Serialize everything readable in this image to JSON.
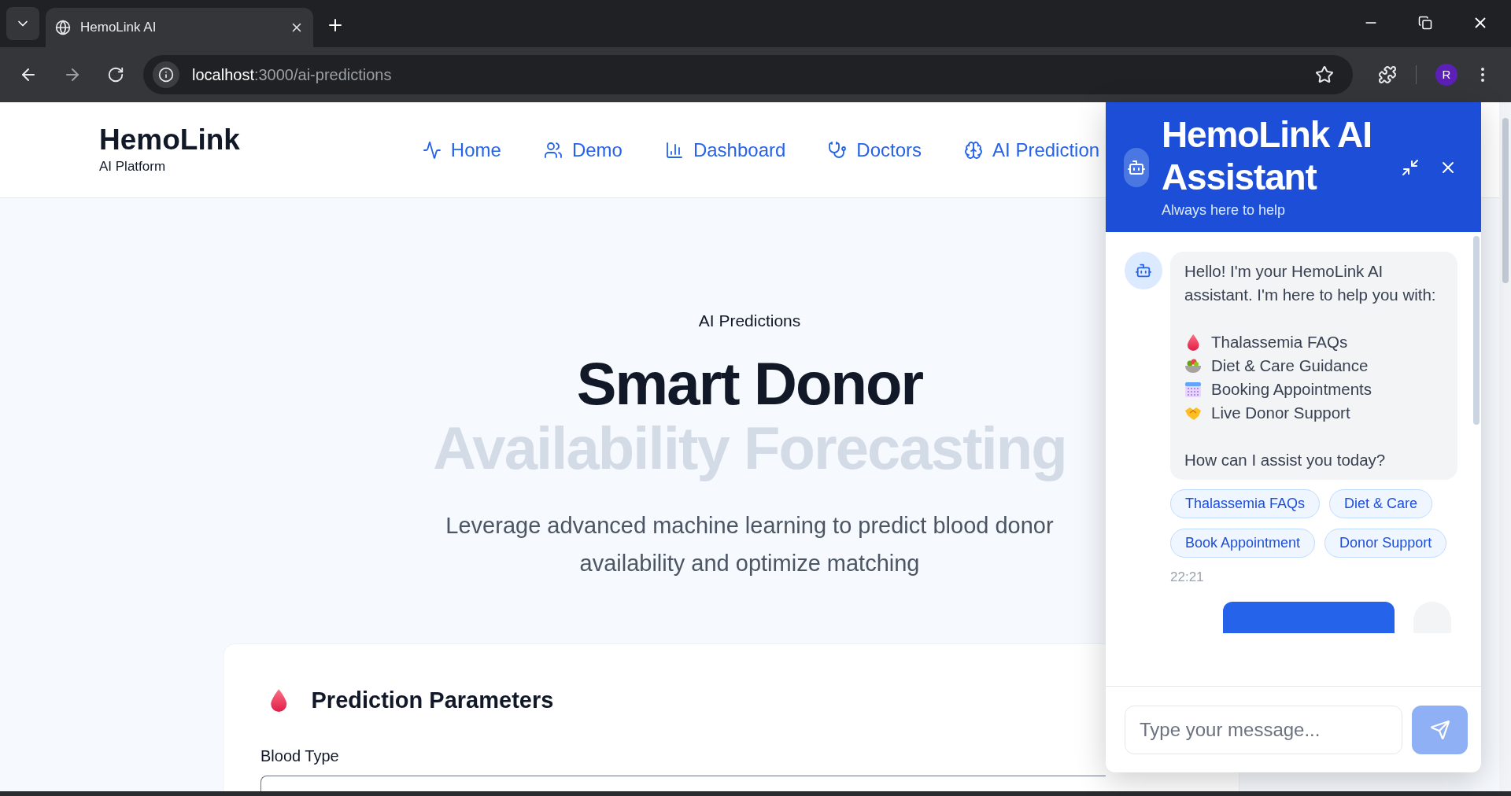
{
  "browser": {
    "tab_title": "HemoLink AI",
    "url_host": "localhost",
    "url_path": ":3000/ai-predictions",
    "profile_initial": "R"
  },
  "header": {
    "brand": "HemoLink",
    "tagline": "AI Platform",
    "nav": [
      {
        "kind": "home",
        "label": "Home"
      },
      {
        "kind": "demo",
        "label": "Demo"
      },
      {
        "kind": "dashboard",
        "label": "Dashboard"
      },
      {
        "kind": "doctors",
        "label": "Doctors"
      },
      {
        "kind": "predictions",
        "label": "AI Prediction"
      }
    ]
  },
  "hero": {
    "eyebrow": "AI Predictions",
    "title": "Smart Donor",
    "title_faded": "Availability Forecasting",
    "subtitle": "Leverage advanced machine learning to predict blood donor availability and optimize matching"
  },
  "card": {
    "title": "Prediction Parameters",
    "field_label": "Blood Type"
  },
  "chat": {
    "title": "HemoLink AI Assistant",
    "subtitle": "Always here to help",
    "greeting": "Hello! I'm your HemoLink AI assistant. I'm here to help you with:",
    "topics": [
      {
        "kind": "drop",
        "label": "Thalassemia FAQs"
      },
      {
        "kind": "salad",
        "label": "Diet & Care Guidance"
      },
      {
        "kind": "calendar",
        "label": "Booking Appointments"
      },
      {
        "kind": "handshake",
        "label": "Live Donor Support"
      }
    ],
    "question": "How can I assist you today?",
    "chips": [
      "Thalassemia FAQs",
      "Diet & Care",
      "Book Appointment",
      "Donor Support"
    ],
    "time": "22:21",
    "input_placeholder": "Type your message..."
  }
}
